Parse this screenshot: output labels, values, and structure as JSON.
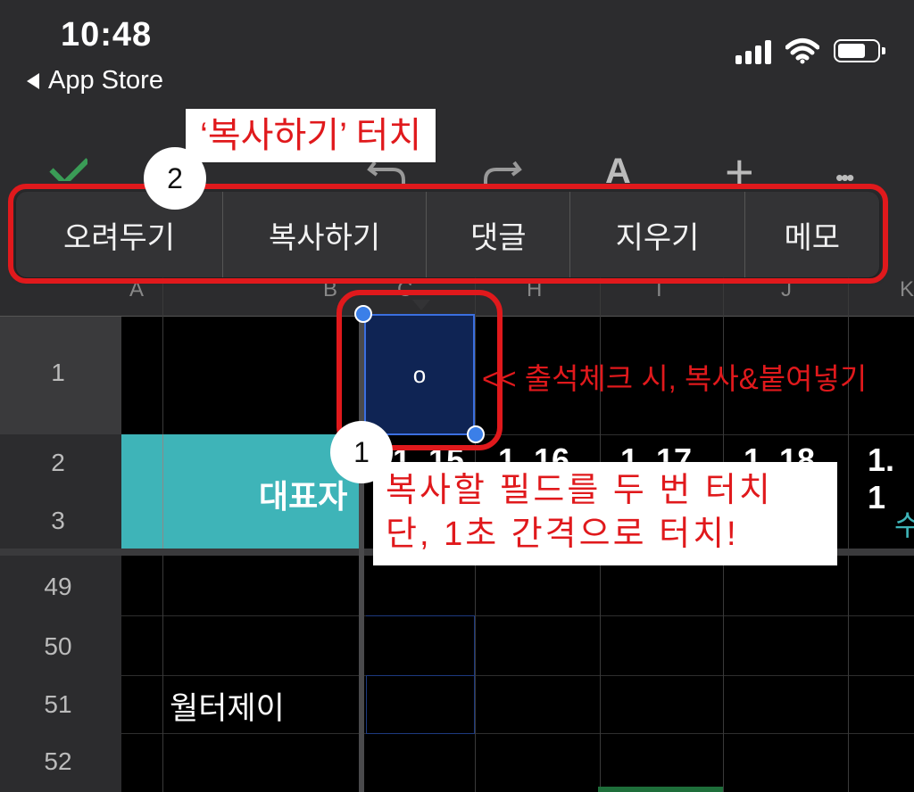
{
  "status_bar": {
    "time": "10:48",
    "back_label": "App Store",
    "icons": [
      "cellular-signal-icon",
      "wifi-icon",
      "battery-icon"
    ]
  },
  "toolbar": {
    "icons": [
      "checkmark-icon",
      "undo-icon",
      "redo-icon",
      "text-format-icon",
      "add-icon",
      "more-icon"
    ],
    "text_format_glyph": "A",
    "add_glyph": "+",
    "more_glyph": "•••"
  },
  "context_menu": {
    "items": [
      "오려두기",
      "복사하기",
      "댓글",
      "지우기",
      "메모"
    ]
  },
  "annotations": {
    "step2_badge": "2",
    "step2_text": "‘복사하기’ 터치",
    "step1_badge": "1",
    "step1_line1": "복사할 필드를 두 번 터치",
    "step1_line2": "단, 1초 간격으로 터치!",
    "arrow_note": "<< 출석체크 시, 복사&붙여넣기"
  },
  "sheet": {
    "column_headers": [
      "A",
      "B",
      "C",
      "H",
      "I",
      "J",
      "K"
    ],
    "row_numbers": [
      "1",
      "2",
      "3",
      "49",
      "50",
      "51",
      "52"
    ],
    "selected_cell_value": "o",
    "merged_header_text": "대표자",
    "date_headers": [
      "1. 15",
      "1. 16",
      "1. 17",
      "1. 18",
      "1. 1"
    ],
    "day_label_partial": "수",
    "name_cell": "월터제이"
  },
  "colors": {
    "annotation_red": "#e0191c",
    "teal": "#3eb4b8",
    "selection_blue": "#3b6fe0"
  }
}
